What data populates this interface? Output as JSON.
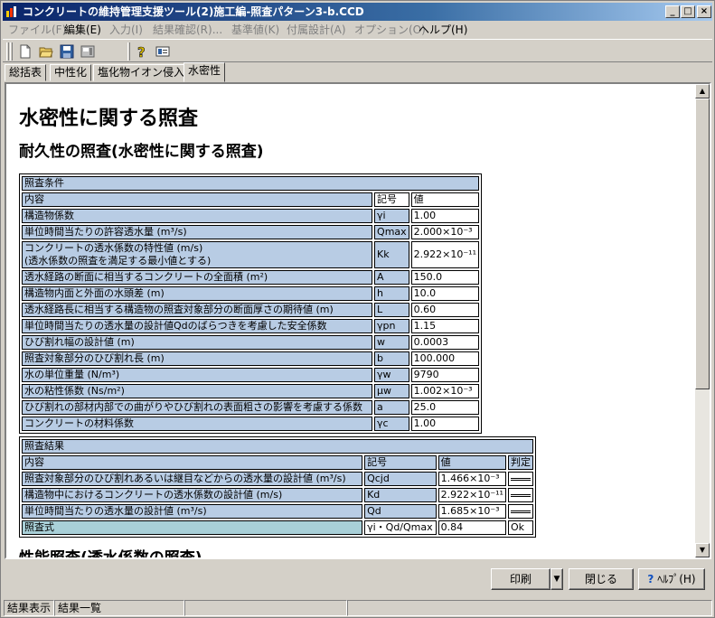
{
  "window": {
    "title": "コンクリートの維持管理支援ツール(2)施工編-照査パターン3-b.CCD",
    "controls": {
      "minimize": "_",
      "maximize": "□",
      "close": "×"
    }
  },
  "menu": [
    {
      "label": "ファイル(F)",
      "enabled": false
    },
    {
      "label": "編集(E)",
      "enabled": true
    },
    {
      "label": "入力(I)",
      "enabled": false
    },
    {
      "label": "結果確認(R)...",
      "enabled": false
    },
    {
      "label": "基準値(K)",
      "enabled": false
    },
    {
      "label": "付属設計(A)",
      "enabled": false
    },
    {
      "label": "オプション(O)",
      "enabled": false
    },
    {
      "label": "ヘルプ(H)",
      "enabled": true
    }
  ],
  "toolbar_icons": [
    "new-file-icon",
    "open-folder-icon",
    "save-disk-icon",
    "export-icon",
    "help-icon",
    "version-info-icon"
  ],
  "tabs": [
    {
      "label": "総括表",
      "active": false
    },
    {
      "label": "中性化",
      "active": false
    },
    {
      "label": "塩化物イオン侵入",
      "active": false
    },
    {
      "label": "水密性",
      "active": true
    }
  ],
  "document": {
    "title": "水密性に関する照査",
    "subtitle": "耐久性の照査(水密性に関する照査)",
    "next_heading_partial": "性能照査(透水係数の照査)"
  },
  "conditions": {
    "section": "照査条件",
    "headers": {
      "content": "内容",
      "symbol": "記号",
      "value": "値"
    },
    "rows": [
      {
        "content": "構造物係数",
        "symbol": "γi",
        "value": "1.00"
      },
      {
        "content": "単位時間当たりの許容透水量 (m³/s)",
        "symbol": "Qmax",
        "value": "2.000×10⁻³"
      },
      {
        "content": "コンクリートの透水係数の特性値 (m/s)",
        "content2": "(透水係数の照査を満足する最小値とする)",
        "symbol": "Kk",
        "value": "2.922×10⁻¹¹"
      },
      {
        "content": "透水経路の断面に相当するコンクリートの全面積 (m²)",
        "symbol": "A",
        "value": "150.0"
      },
      {
        "content": "構造物内面と外面の水頭差 (m)",
        "symbol": "h",
        "value": "10.0"
      },
      {
        "content": "透水経路長に相当する構造物の照査対象部分の断面厚さの期待値 (m)",
        "symbol": "L",
        "value": "0.60"
      },
      {
        "content": "単位時間当たりの透水量の設計値Qdのばらつきを考慮した安全係数",
        "symbol": "γpn",
        "value": "1.15"
      },
      {
        "content": "ひび割れ幅の設計値 (m)",
        "symbol": "w",
        "value": "0.0003"
      },
      {
        "content": "照査対象部分のひび割れ長 (m)",
        "symbol": "b",
        "value": "100.000"
      },
      {
        "content": "水の単位重量 (N/m³)",
        "symbol": "γw",
        "value": "9790"
      },
      {
        "content": "水の粘性係数 (Ns/m²)",
        "symbol": "μw",
        "value": "1.002×10⁻³"
      },
      {
        "content": "ひび割れの部材内部での曲がりやひび割れの表面粗さの影響を考慮する係数",
        "symbol": "a",
        "value": "25.0"
      },
      {
        "content": "コンクリートの材料係数",
        "symbol": "γc",
        "value": "1.00"
      }
    ]
  },
  "results": {
    "section": "照査結果",
    "headers": {
      "content": "内容",
      "symbol": "記号",
      "value": "値",
      "judge": "判定"
    },
    "rows": [
      {
        "content": "照査対象部分のひび割れあるいは継目などからの透水量の設計値 (m³/s)",
        "symbol": "Qcjd",
        "value": "1.466×10⁻³"
      },
      {
        "content": "構造物中におけるコンクリートの透水係数の設計値 (m/s)",
        "symbol": "Kd",
        "value": "2.922×10⁻¹¹"
      },
      {
        "content": "単位時間当たりの透水量の設計値 (m³/s)",
        "symbol": "Qd",
        "value": "1.685×10⁻³"
      }
    ],
    "formula": {
      "content": "照査式",
      "symbol": "γi・Qd/Qmax",
      "value": "0.84",
      "judge": "Ok"
    }
  },
  "buttons": {
    "print": "印刷",
    "close": "閉じる",
    "help": "ﾍﾙﾌﾟ(H)"
  },
  "status": {
    "pane1": "結果表示",
    "pane2": "結果一覧"
  }
}
